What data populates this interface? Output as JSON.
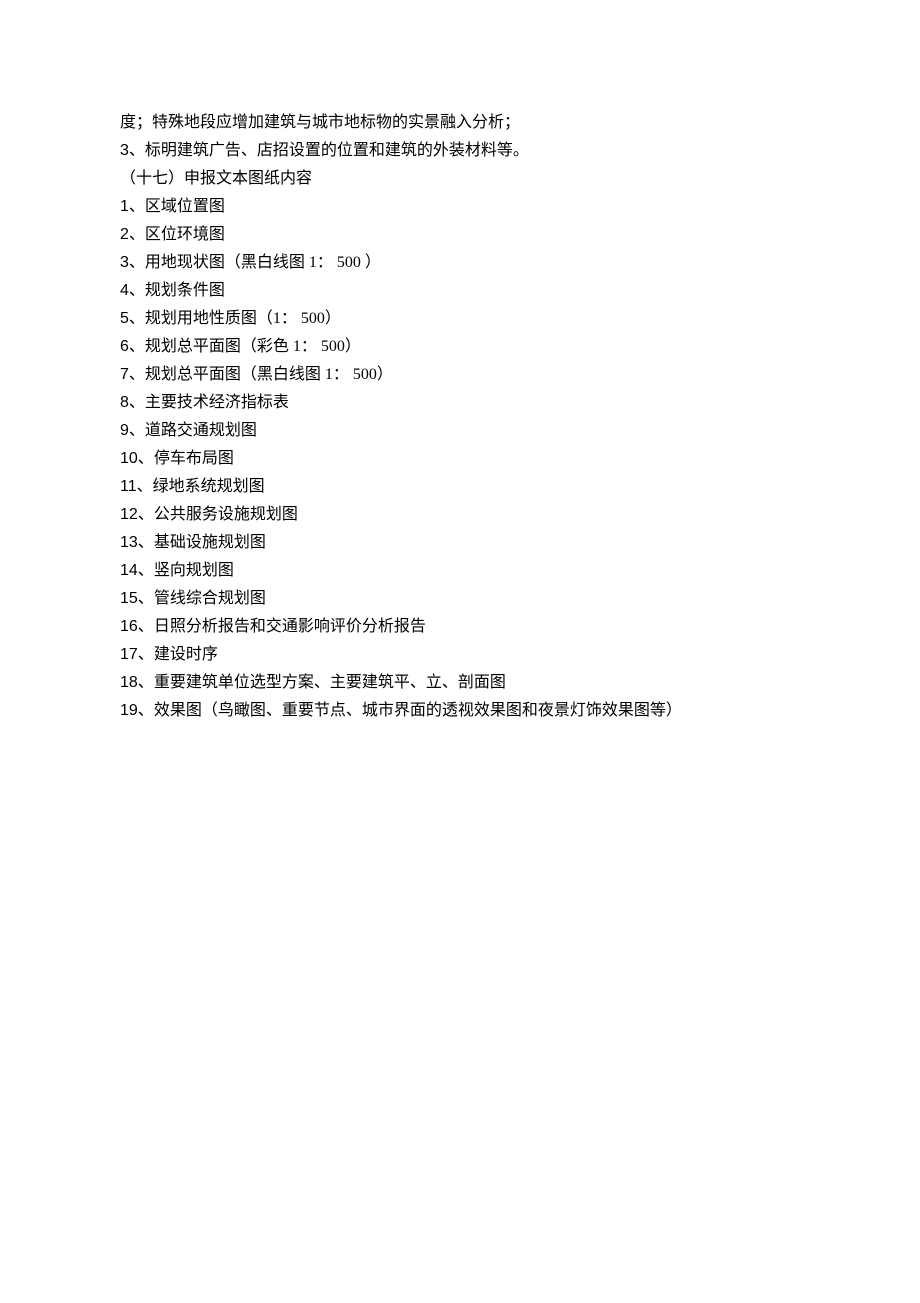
{
  "lines": [
    {
      "num": "",
      "text": "度；特殊地段应增加建筑与城市地标物的实景融入分析；"
    },
    {
      "num": "3、",
      "text": "标明建筑广告、店招设置的位置和建筑的外装材料等。"
    },
    {
      "num": "",
      "text": "（十七）申报文本图纸内容"
    },
    {
      "num": "1、",
      "text": "区域位置图"
    },
    {
      "num": "2、",
      "text": "区位环境图"
    },
    {
      "num": "3、",
      "text": "用地现状图（黑白线图 1：  500 ）"
    },
    {
      "num": "4、",
      "text": "规划条件图"
    },
    {
      "num": "5、",
      "text": "规划用地性质图（1：  500）"
    },
    {
      "num": "6、",
      "text": "规划总平面图（彩色 1：  500）"
    },
    {
      "num": "7、",
      "text": "规划总平面图（黑白线图 1：  500）"
    },
    {
      "num": "8、",
      "text": "主要技术经济指标表"
    },
    {
      "num": "9、",
      "text": "道路交通规划图"
    },
    {
      "num": "10、",
      "text": "停车布局图"
    },
    {
      "num": "11、",
      "text": "绿地系统规划图"
    },
    {
      "num": "12、",
      "text": "公共服务设施规划图"
    },
    {
      "num": "13、",
      "text": "基础设施规划图"
    },
    {
      "num": "14、",
      "text": "竖向规划图"
    },
    {
      "num": "15、",
      "text": "管线综合规划图"
    },
    {
      "num": "16、",
      "text": "日照分析报告和交通影响评价分析报告"
    },
    {
      "num": "17、",
      "text": "建设时序"
    },
    {
      "num": "18、",
      "text": "重要建筑单位选型方案、主要建筑平、立、剖面图"
    },
    {
      "num": "19、",
      "text": "效果图（鸟瞰图、重要节点、城市界面的透视效果图和夜景灯饰效果图等）"
    }
  ]
}
